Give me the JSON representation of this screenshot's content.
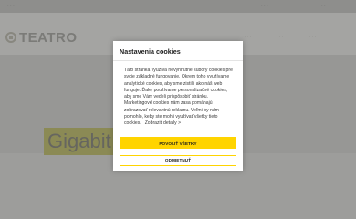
{
  "background": {
    "topbar": {
      "left_text": "· · ·",
      "right_text_1": "· · ·",
      "right_text_2": "· ·"
    },
    "logo": {
      "text": "TEATRO"
    },
    "nav": [
      "· · ·",
      "· · ·",
      "· · ·"
    ],
    "hero_title": "Gigabit"
  },
  "cookie_modal": {
    "title": "Nastavenia cookies",
    "body": "Táto stránka využíva nevyhnutné súbory cookies pre svoje základné fungovanie. Okrem toho využívame analytické cookies, aby sme zistili, ako náš web funguje. Ďalej používame personalizačné cookies, aby sme Vám vedeli prispôsobiť stránku. Marketingové cookies nám zasa pomáhajú zobrazovať relevantnú reklamu. Veľmi by nám pomohlo, keby ste mohli využívať všetky tieto cookies.",
    "details_link": "Zobraziť detaily >",
    "accept_label": "POVOLIŤ VŠETKY",
    "decline_label": "ODMIETNUŤ"
  },
  "colors": {
    "accent": "#ffd400",
    "overlay": "#9a9a98"
  }
}
